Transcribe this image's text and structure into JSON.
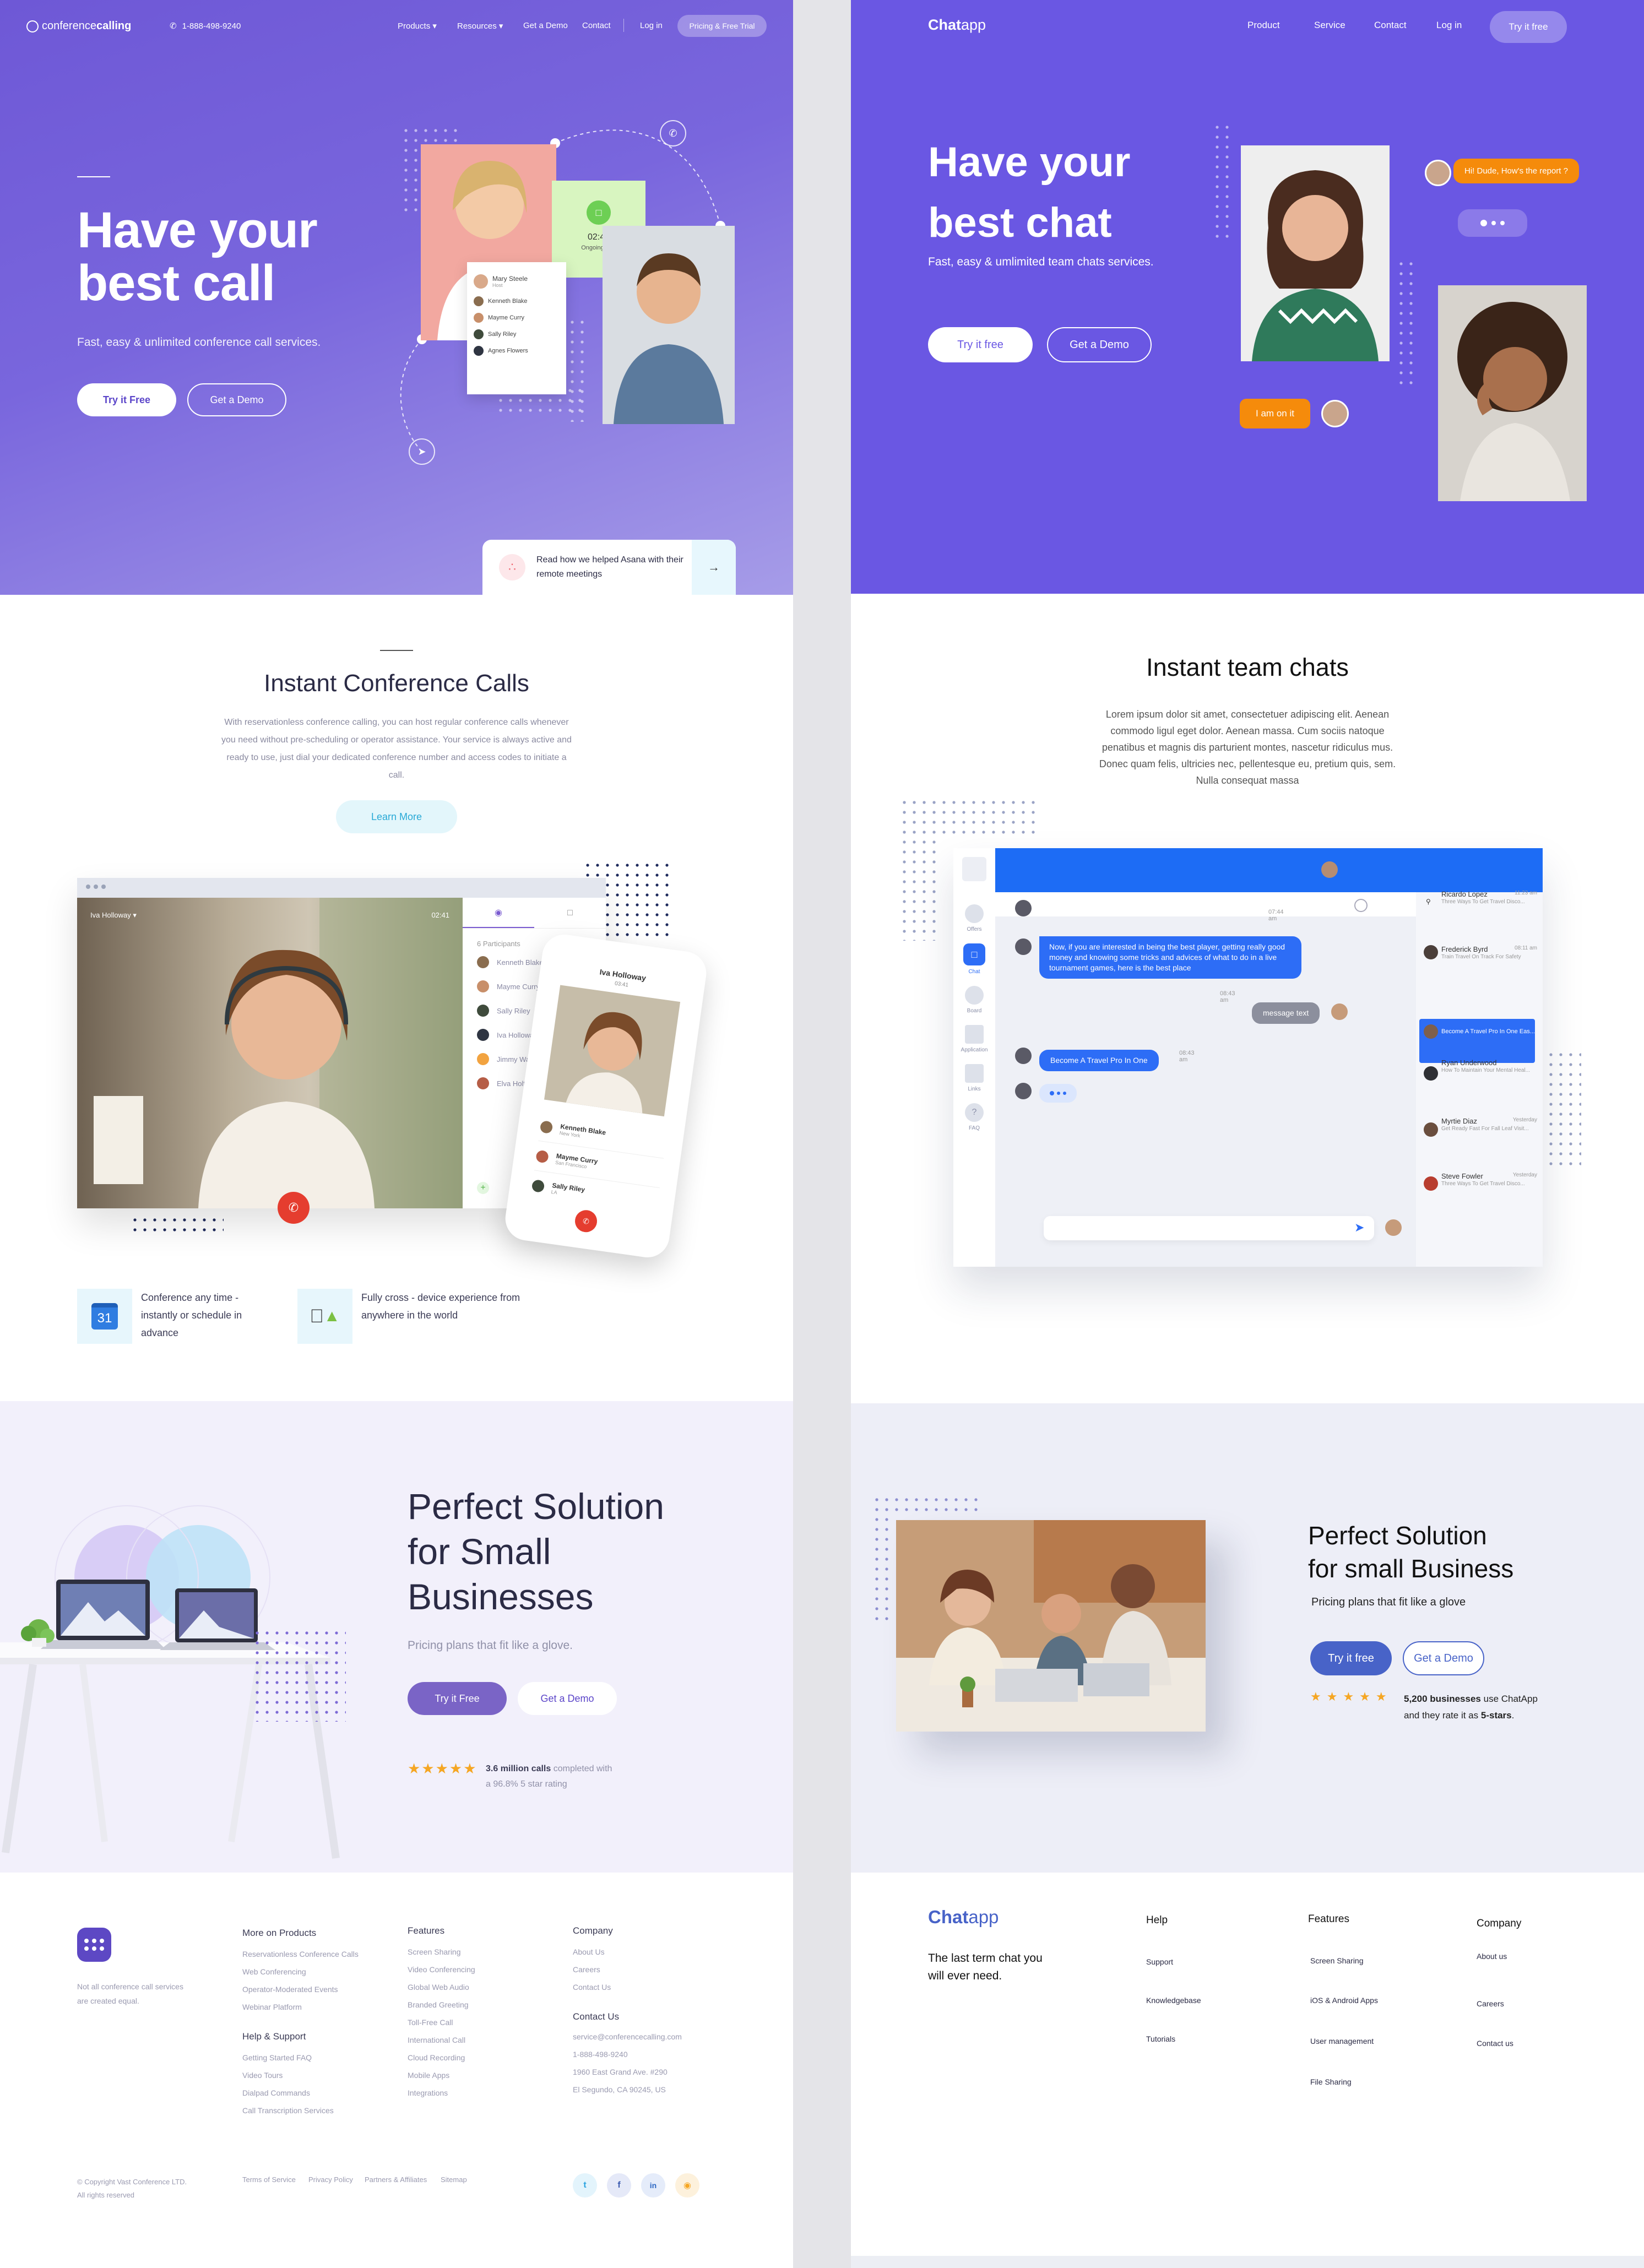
{
  "left": {
    "nav": {
      "logo_prefix": "conference",
      "logo_suffix": "calling",
      "phone": "1-888-498-9240",
      "items": [
        "Products",
        "Resources",
        "Get a Demo",
        "Contact",
        "Log in"
      ],
      "cta": "Pricing & Free Trial"
    },
    "hero": {
      "title_line1": "Have your",
      "title_line2": "best call",
      "subtitle": "Fast, easy & unlimited conference call services.",
      "btn_primary": "Try it Free",
      "btn_secondary": "Get a Demo",
      "call_time": "02:45",
      "call_status": "Ongoing Call",
      "card_user": "Mary Steele",
      "card_user_role": "Host",
      "card_participants": [
        "Kenneth Blake",
        "Mayme Curry",
        "Sally Riley",
        "Agnes Flowers"
      ],
      "asana_text": "Read how we helped Asana with their remote meetings"
    },
    "instant": {
      "title": "Instant Conference Calls",
      "body": "With reservationless conference calling, you can host regular conference calls whenever you need without pre-scheduling or operator assistance. Your service is always active and ready to use, just dial your dedicated conference number and access codes to initiate a call.",
      "btn": "Learn More"
    },
    "video": {
      "caller_name": "Iva Holloway",
      "call_timer": "02:41",
      "participants_label": "6 Participants",
      "participants": [
        "Kenneth Blake",
        "Mayme Curry",
        "Sally Riley",
        "Iva Holloway",
        "Jimmy Warner",
        "Elva Holt"
      ],
      "phone_name": "Iva Holloway",
      "phone_timer": "03:41",
      "phone_list": [
        {
          "name": "Kenneth Blake",
          "city": "New York"
        },
        {
          "name": "Mayme Curry",
          "city": "San Francisco"
        },
        {
          "name": "Sally Riley",
          "city": "LA"
        }
      ]
    },
    "features": [
      {
        "icon": "calendar-icon",
        "badge": "31",
        "text": "Conference any time - instantly or schedule in advance"
      },
      {
        "icon": "apple-android-icon",
        "text": "Fully cross - device experience from anywhere in the world"
      }
    ],
    "solution": {
      "title_line1": "Perfect Solution",
      "title_line2": "for Small",
      "title_line3": "Businesses",
      "subtitle": "Pricing plans that fit like a glove.",
      "btn_primary": "Try it Free",
      "btn_secondary": "Get a Demo",
      "rating_bold": "3.6 million calls",
      "rating_text1": "completed with",
      "rating_text2": "a 96.8% 5 star rating",
      "star_color": "#f5a623"
    },
    "footer": {
      "tagline": "Not all conference call services are created equal.",
      "products_title": "More on Products",
      "products": [
        "Reservationless Conference Calls",
        "Web Conferencing",
        "Operator-Moderated Events",
        "Webinar Platform"
      ],
      "help_title": "Help & Support",
      "help": [
        "Getting Started FAQ",
        "Video Tours",
        "Dialpad Commands",
        "Call Transcription Services"
      ],
      "features_title": "Features",
      "features": [
        "Screen Sharing",
        "Video Conferencing",
        "Global Web Audio",
        "Branded Greeting",
        "Toll-Free Call",
        "International Call",
        "Cloud Recording",
        "Mobile Apps",
        "Integrations"
      ],
      "company_title": "Company",
      "company": [
        "About Us",
        "Careers",
        "Contact Us"
      ],
      "contact_title": "Contact Us",
      "contact": [
        "service@conferencecalling.com",
        "1-888-498-9240",
        "1960 East Grand Ave. #290",
        "El Segundo, CA 90245, US"
      ],
      "copyright1": "© Copyright Vast Conference LTD.",
      "copyright2": "All rights reserved",
      "legal": [
        "Terms of Service",
        "Privacy Policy",
        "Partners & Affiliates",
        "Sitemap"
      ]
    }
  },
  "right": {
    "nav": {
      "logo_prefix": "Chat",
      "logo_suffix": "app",
      "items": [
        "Product",
        "Service",
        "Contact",
        "Log in"
      ],
      "cta": "Try it free"
    },
    "hero": {
      "title_line1": "Have your",
      "title_line2": "best chat",
      "subtitle": "Fast, easy & umlimited team chats services.",
      "btn_primary": "Try it free",
      "btn_secondary": "Get a Demo",
      "bubble_top": "Hi! Dude, How's the report ?",
      "bubble_bottom": "I am on it"
    },
    "instant": {
      "title": "Instant team chats",
      "body": "Lorem ipsum dolor sit amet, consectetuer adipiscing elit. Aenean commodo ligul eget dolor. Aenean massa. Cum sociis natoque penatibus et magnis dis parturient montes, nascetur ridiculus mus. Donec quam felis, ultricies nec, pellentesque eu, pretium quis, sem. Nulla consequat massa"
    },
    "chat": {
      "sidebar": [
        "Offers",
        "Chat",
        "Board",
        "Application",
        "Links",
        "FAQ"
      ],
      "time1": "07:44 am",
      "msg1": "Now, if you are interested in being the best player, getting really good money and knowing some tricks and advices of what to do in a live tournament games, here is the best place",
      "time2": "08:43 am",
      "msg2": "message text",
      "msg3": "Become A Travel Pro In One",
      "time3": "08:43 am",
      "contacts": [
        {
          "name": "Ricardo Lopez",
          "time": "11:23 am",
          "preview": "Three Ways To Get Travel Disco..."
        },
        {
          "name": "Frederick Byrd",
          "time": "08:11 am",
          "preview": "Train Travel On Track For Safety"
        },
        {
          "name": "",
          "time": "",
          "preview": "Become A Travel Pro In One Eas..."
        },
        {
          "name": "Ryan Underwood",
          "time": "",
          "preview": "How To Maintain Your Mental Heal..."
        },
        {
          "name": "Myrtie Diaz",
          "time": "Yesterday",
          "preview": "Get Ready Fast For Fall Leaf Visit..."
        },
        {
          "name": "Steve Fowler",
          "time": "Yesterday",
          "preview": "Three Ways To Get Travel Disco..."
        }
      ]
    },
    "solution": {
      "title_line1": "Perfect Solution",
      "title_line2": "for small Business",
      "subtitle": "Pricing plans that fit like a glove",
      "btn_primary": "Try it free",
      "btn_secondary": "Get a Demo",
      "rating_bold": "5,200 businesses",
      "rating_text1": "use ChatApp",
      "rating_text2a": "and they rate it as",
      "rating_text2b": "5-stars",
      "star_color": "#f5a623"
    },
    "footer": {
      "tagline": "The last term chat you will ever need.",
      "help_title": "Help",
      "help": [
        "Support",
        "Knowledgebase",
        "Tutorials"
      ],
      "features_title": "Features",
      "features": [
        "Screen Sharing",
        "iOS & Android Apps",
        "User management",
        "File Sharing"
      ],
      "company_title": "Company",
      "company": [
        "About us",
        "Careers",
        "Contact us"
      ]
    }
  }
}
